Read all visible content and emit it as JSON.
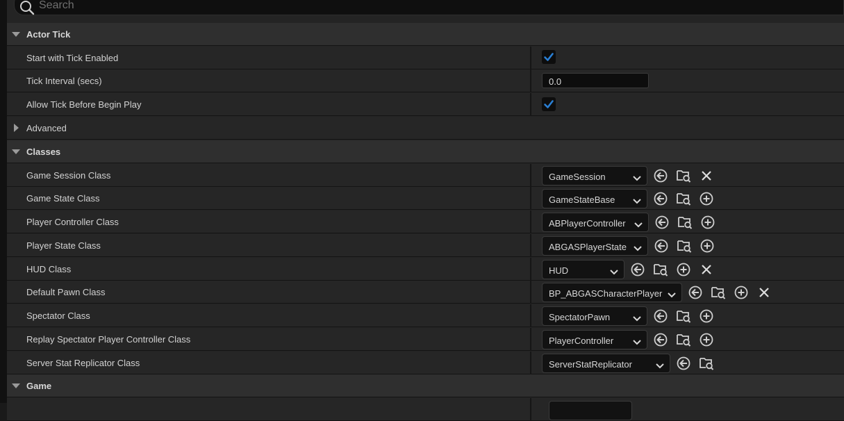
{
  "search": {
    "placeholder": "Search",
    "icon": "search-icon"
  },
  "sections": {
    "actor_tick": {
      "title": "Actor Tick",
      "start_with_tick_enabled": {
        "label": "Start with Tick Enabled",
        "checked": true
      },
      "tick_interval": {
        "label": "Tick Interval (secs)",
        "value": "0.0"
      },
      "allow_tick_before_begin_play": {
        "label": "Allow Tick Before Begin Play",
        "checked": true
      },
      "advanced": {
        "label": "Advanced"
      }
    },
    "classes": {
      "title": "Classes",
      "rows": [
        {
          "label": "Game Session Class",
          "value": "GameSession",
          "icons": [
            "browse-back-icon",
            "browse-asset-icon",
            "clear-icon"
          ]
        },
        {
          "label": "Game State Class",
          "value": "GameStateBase",
          "icons": [
            "browse-back-icon",
            "browse-asset-icon",
            "add-icon"
          ]
        },
        {
          "label": "Player Controller Class",
          "value": "ABPlayerController",
          "icons": [
            "browse-back-icon",
            "browse-asset-icon",
            "add-icon"
          ]
        },
        {
          "label": "Player State Class",
          "value": "ABGASPlayerState",
          "icons": [
            "browse-back-icon",
            "browse-asset-icon",
            "add-icon"
          ]
        },
        {
          "label": "HUD Class",
          "value": "HUD",
          "icons": [
            "browse-back-icon",
            "browse-asset-icon",
            "add-icon",
            "clear-icon"
          ]
        },
        {
          "label": "Default Pawn Class",
          "value": "BP_ABGASCharacterPlayer",
          "icons": [
            "browse-back-icon",
            "browse-asset-icon",
            "add-icon",
            "clear-icon"
          ]
        },
        {
          "label": "Spectator Class",
          "value": "SpectatorPawn",
          "icons": [
            "browse-back-icon",
            "browse-asset-icon",
            "add-icon"
          ]
        },
        {
          "label": "Replay Spectator Player Controller Class",
          "value": "PlayerController",
          "icons": [
            "browse-back-icon",
            "browse-asset-icon",
            "add-icon"
          ]
        },
        {
          "label": "Server Stat Replicator Class",
          "value": "ServerStatReplicator",
          "icons": [
            "browse-back-icon",
            "browse-asset-icon"
          ]
        }
      ]
    },
    "game": {
      "title": "Game"
    }
  },
  "colors": {
    "accent_check": "#2a7fd4",
    "panel_bg": "#242424",
    "category_bg": "#2f2f2f"
  }
}
